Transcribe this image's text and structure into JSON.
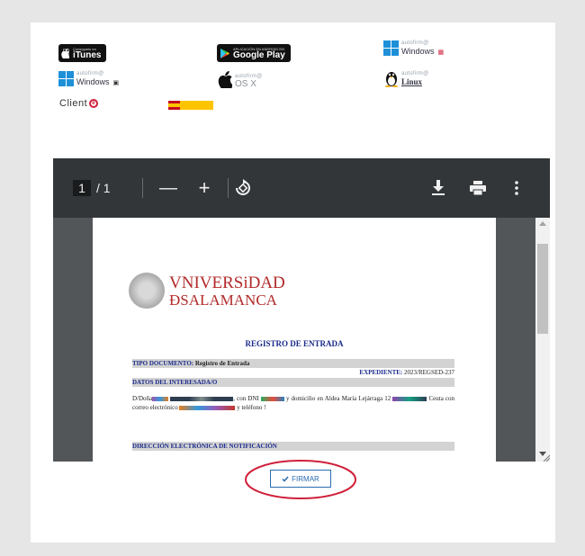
{
  "downloads": {
    "itunes": {
      "small": "Consíguelo en",
      "big": "iTunes"
    },
    "google_play": {
      "small": "APLICACIÓN EN ANDROID EN",
      "big": "Google Play"
    },
    "autofirma_windows": {
      "brand": "autofirm@",
      "os": "Windows"
    },
    "autofirma_osx": {
      "brand": "autofirm@",
      "os": "OS X"
    },
    "autofirma_linux": {
      "brand": "autofirm@",
      "os": "Linux"
    },
    "client_windows": {
      "brand": "autofirm@",
      "os": "Windows"
    },
    "client_e": {
      "label": "Client"
    }
  },
  "viewer": {
    "current_page": "1",
    "total_pages": "/ 1",
    "zoom_out": "—",
    "zoom_in": "+",
    "rotate": "⟲",
    "download": "⤓",
    "print": "⎙",
    "more": "⋮"
  },
  "document": {
    "university_line1": "VNIVERSiDAD",
    "university_line2": "ÐSALAMANCA",
    "title": "REGISTRO DE ENTRADA",
    "tipo_label": "TIPO DOCUMENTO:",
    "tipo_value": "Registro de Entrada",
    "expediente_label": "EXPEDIENTE:",
    "expediente_value": "2023/REGSED-237",
    "datos_label": "DATOS DEL INTERESADA/O",
    "body_a": "D/Doña",
    "body_b": ", con DNI",
    "body_c": "y domicilio en Aldea María",
    "body_d": "Lejárraga 12",
    "body_e": "Ceuta con correo electrónico",
    "body_f": "y teléfono",
    "body_g": "!",
    "direccion_label": "DIRECCIÓN ELECTRÓNICA DE NOTIFICACIÓN"
  },
  "actions": {
    "firmar_label": "FIRMAR",
    "firmar_icon": "check-icon"
  },
  "colors": {
    "accent": "#2b6cb0",
    "brand_red": "#b22a2a",
    "ellipse": "#d0203a"
  }
}
